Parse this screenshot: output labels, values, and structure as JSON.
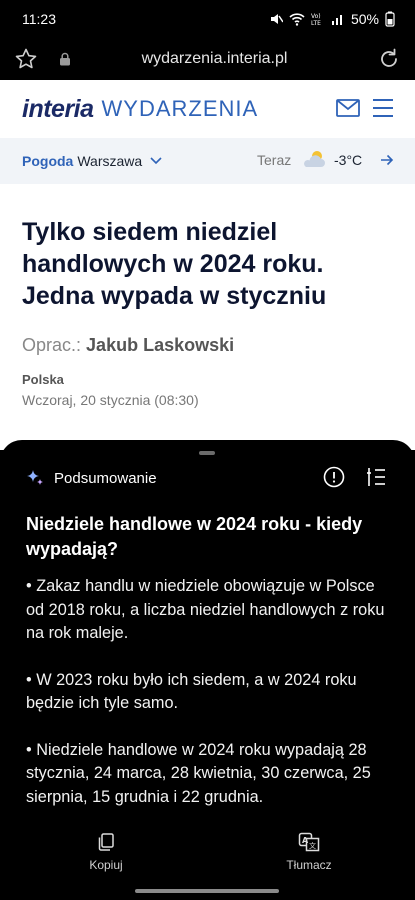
{
  "status": {
    "time": "11:23",
    "battery": "50%",
    "icons": [
      "mute-icon",
      "wifi-icon",
      "volte-icon",
      "signal-icon",
      "battery-icon"
    ]
  },
  "browser": {
    "url": "wydarzenia.interia.pl"
  },
  "site": {
    "brand": "interia",
    "section": "WYDARZENIA",
    "accent": "#2f63b8",
    "brand_color": "#1b2a66"
  },
  "weather": {
    "label": "Pogoda",
    "city": "Warszawa",
    "now": "Teraz",
    "temp": "-3°C"
  },
  "article": {
    "headline": "Tylko siedem niedziel handlowych w 2024 roku. Jedna wypada w styczniu",
    "author_prefix": "Oprac.:",
    "author": "Jakub Laskowski",
    "category": "Polska",
    "date": "Wczoraj, 20 stycznia (08:30)"
  },
  "summary": {
    "panel_title": "Podsumowanie",
    "title": "Niedziele handlowe w 2024 roku - kiedy wypadają?",
    "bullets": [
      "• Zakaz handlu w niedziele obowiązuje w Polsce od 2018 roku, a liczba niedziel handlowych z roku na rok maleje.",
      "• W 2023 roku było ich siedem, a w 2024 roku będzie ich tyle samo.",
      "• Niedziele handlowe w 2024 roku wypadają 28 stycznia, 24 marca, 28 kwietnia, 30 czerwca, 25 sierpnia, 15 grudnia i 22 grudnia."
    ],
    "copy_label": "Kopiuj",
    "translate_label": "Tłumacz"
  }
}
